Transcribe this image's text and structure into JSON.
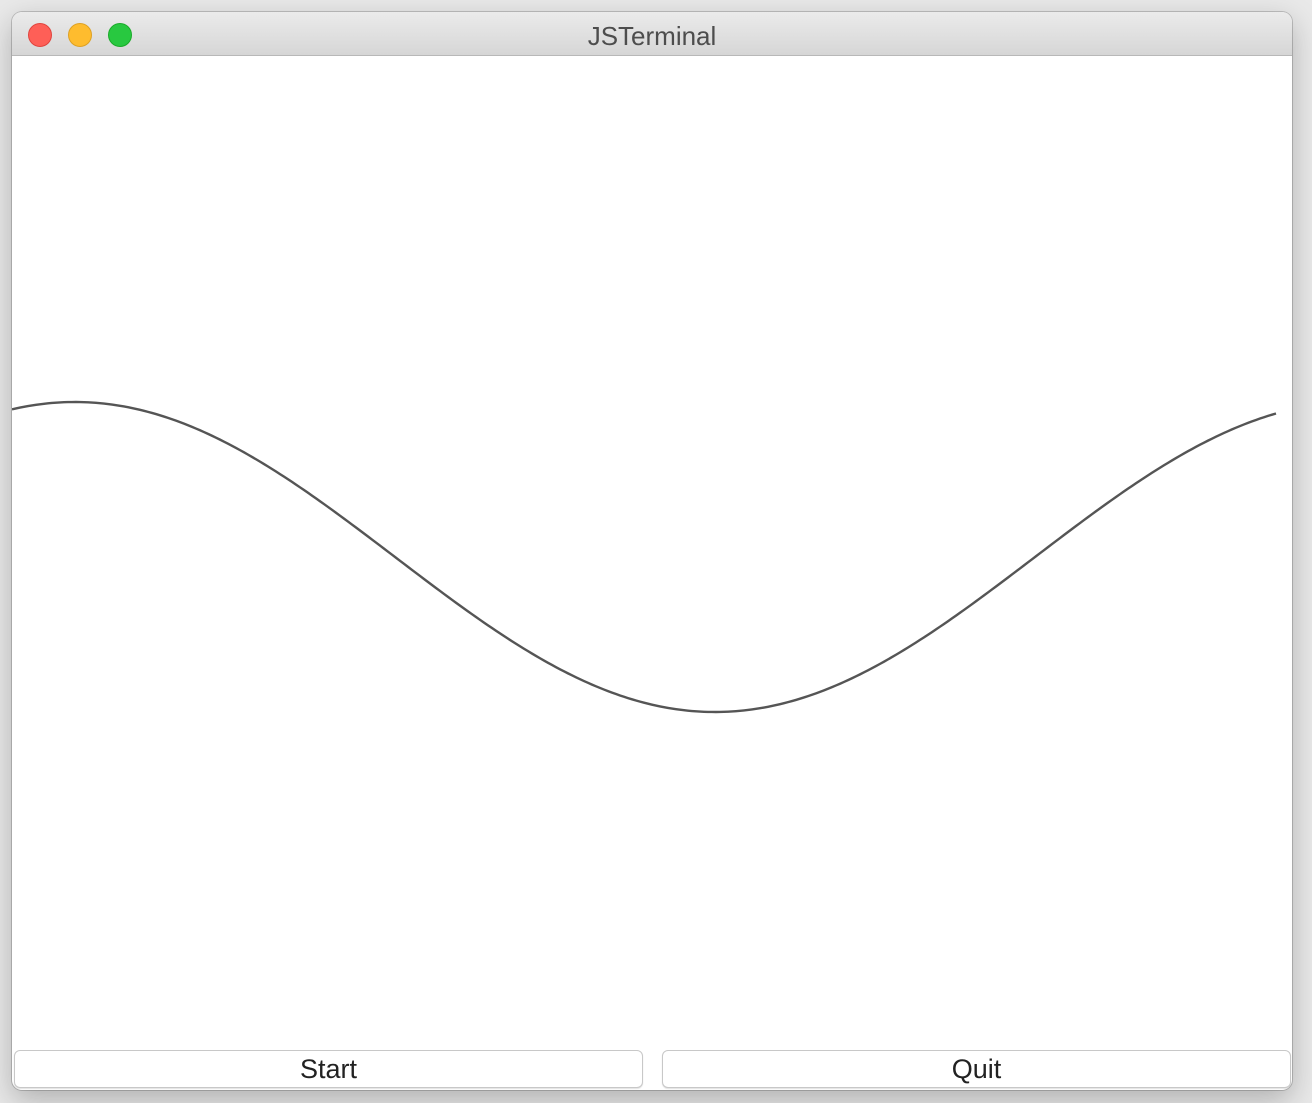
{
  "window": {
    "title": "JSTerminal"
  },
  "canvas": {
    "curve": "sine-wave",
    "curve_color": "#555555"
  },
  "buttons": {
    "start_label": "Start",
    "quit_label": "Quit"
  },
  "colors": {
    "close": "#fe5f57",
    "minimize": "#febc2e",
    "maximize": "#28c840"
  }
}
